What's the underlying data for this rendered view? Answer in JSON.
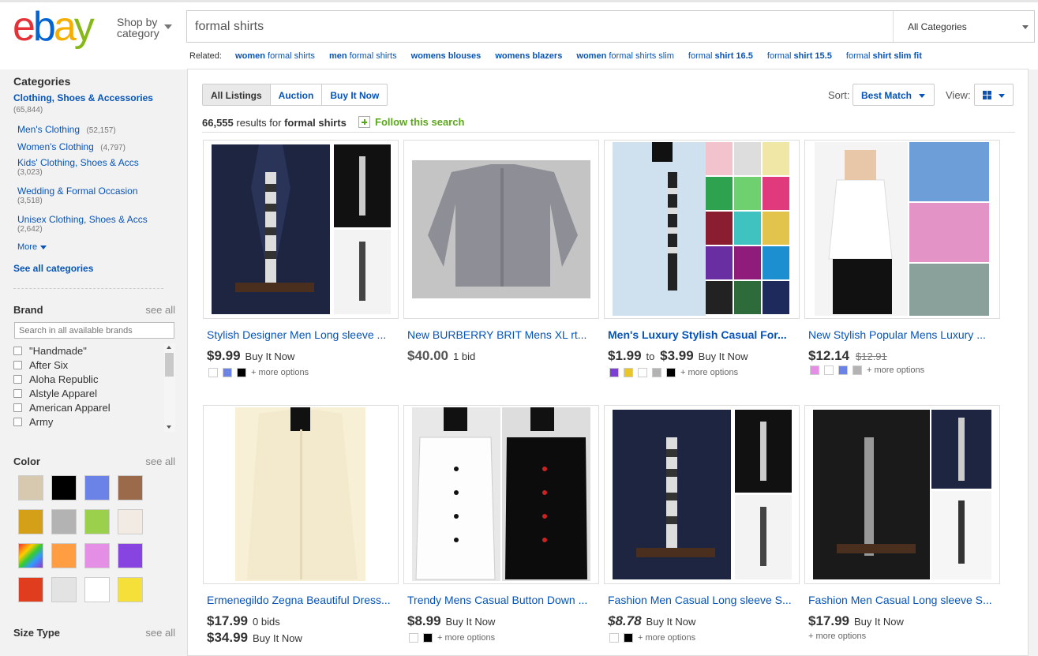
{
  "header": {
    "logo": "ebay",
    "shop_by": [
      "Shop by",
      "category"
    ],
    "search_value": "formal shirts",
    "category_select": "All Categories",
    "related_label": "Related:",
    "related": [
      {
        "pre": "women",
        "post": " formal shirts"
      },
      {
        "pre": "men",
        "post": " formal shirts"
      },
      {
        "pre": "womens blouses",
        "post": ""
      },
      {
        "pre": "womens blazers",
        "post": ""
      },
      {
        "pre": "women",
        "post": " formal shirts slim"
      },
      {
        "pre": "formal",
        "post": " shirt 16.5"
      },
      {
        "pre": "formal",
        "post": " shirt 15.5"
      },
      {
        "pre": "formal",
        "post": " shirt slim fit"
      }
    ]
  },
  "sidebar": {
    "categories_heading": "Categories",
    "top_category": "Clothing, Shoes & Accessories",
    "top_count": "(65,844)",
    "cats": [
      {
        "label": "Men's Clothing",
        "count": "(52,157)"
      },
      {
        "label": "Women's Clothing",
        "count": "(4,797)"
      },
      {
        "label": "Kids' Clothing, Shoes & Accs",
        "count": "(3,023)"
      },
      {
        "label": "Wedding & Formal Occasion",
        "count": "(3,518)"
      },
      {
        "label": "Unisex Clothing, Shoes & Accs",
        "count": "(2,642)"
      }
    ],
    "more": "More",
    "see_all_categories": "See all categories",
    "brand_heading": "Brand",
    "see_all": "see all",
    "brand_placeholder": "Search in all available brands",
    "brands": [
      "\"Handmade\"",
      "After Six",
      "Aloha Republic",
      "Alstyle Apparel",
      "American Apparel",
      "Army"
    ],
    "color_heading": "Color",
    "colors": [
      "#d7c8b0",
      "#000000",
      "#6b82e6",
      "#9b6a4b",
      "#d4a017",
      "#b3b3b3",
      "#9bd04c",
      "#f1ebe3",
      "multicolor",
      "#ff9d42",
      "#e48ee6",
      "#8844e0",
      "#e03c1e",
      "#e3e3e3",
      "#ffffff",
      "#f5e03a"
    ],
    "size_type_heading": "Size Type"
  },
  "toolbar": {
    "tabs": [
      "All Listings",
      "Auction",
      "Buy It Now"
    ],
    "sort_label": "Sort:",
    "sort_value": "Best Match",
    "view_label": "View:",
    "results_count": "66,555",
    "results_for": " results for ",
    "results_query": "formal shirts",
    "follow": "Follow this search"
  },
  "listings": [
    {
      "title": "Stylish Designer Men Long sleeve ...",
      "price": "$9.99",
      "format": "Buy It Now",
      "swatches": [
        "#ffffff",
        "#6b82e6",
        "#000000"
      ],
      "more": "+ more options"
    },
    {
      "title": "New BURBERRY BRIT Mens XL rt...",
      "price": "$40.00",
      "format": "1 bid"
    },
    {
      "title": "Men's Luxury Stylish Casual For...",
      "price": "$1.99",
      "price_to": "to",
      "price_hi": "$3.99",
      "format": "Buy It Now",
      "swatches": [
        "#7b3fd4",
        "#e8c52b",
        "#ffffff",
        "#b3b3b3",
        "#000000"
      ],
      "more": "+ more options"
    },
    {
      "title": "New Stylish Popular Mens Luxury ...",
      "price": "$12.14",
      "was": "$12.91",
      "swatches": [
        "#e48ee6",
        "#ffffff",
        "#6b82e6",
        "#b3b3b3"
      ],
      "more": "+ more options"
    },
    {
      "title": "Ermenegildo Zegna Beautiful Dress...",
      "price": "$17.99",
      "format": "0 bids",
      "price2": "$34.99",
      "format2": "Buy It Now"
    },
    {
      "title": "Trendy Mens Casual Button Down ...",
      "price": "$8.99",
      "format": "Buy It Now",
      "swatches": [
        "#ffffff",
        "#000000"
      ],
      "more": "+ more options"
    },
    {
      "title": "Fashion Men Casual Long sleeve S...",
      "price": "$8.78",
      "format": "Buy It Now",
      "swatches": [
        "#ffffff",
        "#000000"
      ],
      "more": "+ more options"
    },
    {
      "title": "Fashion Men Casual Long sleeve S...",
      "price": "$17.99",
      "format": "Buy It Now",
      "more": "+ more options"
    }
  ]
}
